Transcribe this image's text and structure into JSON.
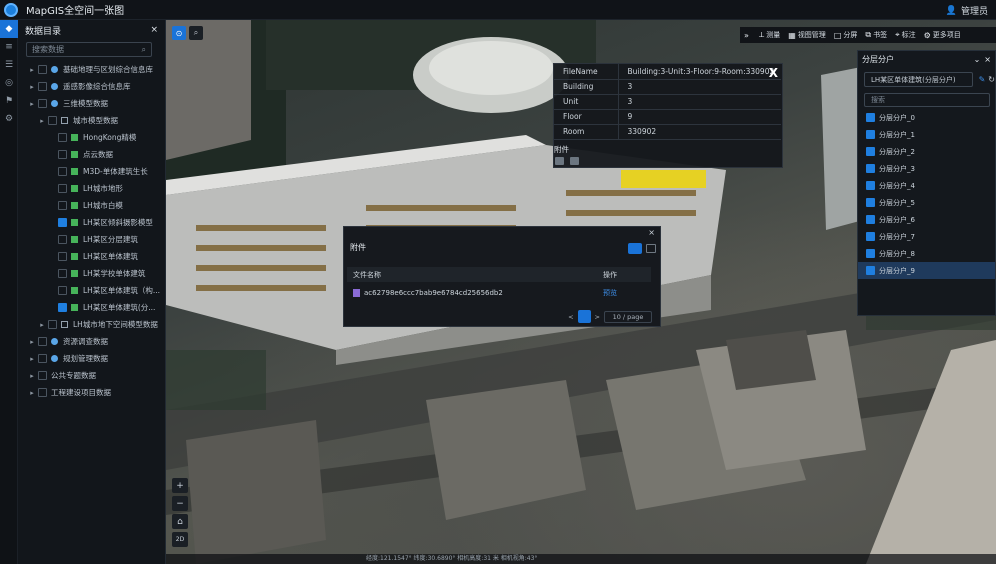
{
  "app": {
    "title": "MapGIS全空间一张图",
    "user": "管理员"
  },
  "left_panel": {
    "title": "数据目录",
    "search_placeholder": "搜索数据",
    "tree": [
      {
        "label": "基础地理与区划综合信息库",
        "depth": 0,
        "type": "dot",
        "checked": false
      },
      {
        "label": "遥感影像综合信息库",
        "depth": 0,
        "type": "dot",
        "checked": false
      },
      {
        "label": "三维模型数据",
        "depth": 0,
        "type": "dot",
        "checked": false
      },
      {
        "label": "城市模型数据",
        "depth": 1,
        "type": "folder",
        "checked": false
      },
      {
        "label": "HongKong精模",
        "depth": 2,
        "type": "layer",
        "checked": false
      },
      {
        "label": "点云数据",
        "depth": 2,
        "type": "layer",
        "checked": false
      },
      {
        "label": "M3D-单体建筑生长",
        "depth": 2,
        "type": "layer",
        "checked": false
      },
      {
        "label": "LH城市地形",
        "depth": 2,
        "type": "layer",
        "checked": false
      },
      {
        "label": "LH城市白模",
        "depth": 2,
        "type": "layer",
        "checked": false
      },
      {
        "label": "LH某区倾斜摄影模型",
        "depth": 2,
        "type": "layer",
        "checked": true
      },
      {
        "label": "LH某区分层建筑",
        "depth": 2,
        "type": "layer",
        "checked": false
      },
      {
        "label": "LH某区单体建筑",
        "depth": 2,
        "type": "layer",
        "checked": false
      },
      {
        "label": "LH某学校单体建筑",
        "depth": 2,
        "type": "layer",
        "checked": false
      },
      {
        "label": "LH某区单体建筑（构...",
        "depth": 2,
        "type": "layer",
        "checked": false
      },
      {
        "label": "LH某区单体建筑(分...",
        "depth": 2,
        "type": "layer",
        "checked": true
      },
      {
        "label": "LH城市地下空间模型数据",
        "depth": 1,
        "type": "folder",
        "checked": false
      },
      {
        "label": "资源调查数据",
        "depth": 0,
        "type": "dot",
        "checked": false
      },
      {
        "label": "规划管理数据",
        "depth": 0,
        "type": "dot",
        "checked": false
      },
      {
        "label": "公共专题数据",
        "depth": 0,
        "type": "none",
        "checked": false
      },
      {
        "label": "工程建设项目数据",
        "depth": 0,
        "type": "none",
        "checked": false
      }
    ]
  },
  "toolbar": {
    "items": [
      {
        "icon": "chevrons-icon",
        "label": ""
      },
      {
        "icon": "measure-icon",
        "label": "测量"
      },
      {
        "icon": "grid-icon",
        "label": "视图管理"
      },
      {
        "icon": "square-icon",
        "label": "分屏"
      },
      {
        "icon": "layer-icon",
        "label": "书签"
      },
      {
        "icon": "pin-icon",
        "label": "标注"
      },
      {
        "icon": "gear-icon",
        "label": "更多项目"
      }
    ]
  },
  "attribute_popup": {
    "rows": [
      {
        "key": "FileName",
        "value": "Building:3-Unit:3-Floor:9-Room:330902"
      },
      {
        "key": "Building",
        "value": "3"
      },
      {
        "key": "Unit",
        "value": "3"
      },
      {
        "key": "Floor",
        "value": "9"
      },
      {
        "key": "Room",
        "value": "330902"
      }
    ],
    "attachments_label": "附件",
    "close": "X"
  },
  "attachment_dialog": {
    "title": "附件",
    "close": "×",
    "columns": [
      "文件名称",
      "操作"
    ],
    "files": [
      {
        "name": "ac62798e6ccc7bab9e6784cd25656db2",
        "action": "预览"
      }
    ],
    "pager": {
      "prev": "<",
      "next": ">",
      "page_size": "10 / page"
    }
  },
  "household_panel": {
    "title": "分层分户",
    "selected_layer": "LH某区单体建筑(分层分户)",
    "search_placeholder": "搜索",
    "items": [
      "分层分户_0",
      "分层分户_1",
      "分层分户_2",
      "分层分户_3",
      "分层分户_4",
      "分层分户_5",
      "分层分户_6",
      "分层分户_7",
      "分层分户_8",
      "分层分户_9"
    ]
  },
  "map": {
    "status": "经度:121.1547° 纬度:30.6890° 相机高度:31 米 相机视角:43°",
    "zoom_in": "+",
    "zoom_out": "−",
    "home": "⌂",
    "mode": "2D"
  },
  "colors": {
    "accent": "#1a73d8",
    "panel": "#12161b",
    "highlight": "#e8d21a"
  }
}
